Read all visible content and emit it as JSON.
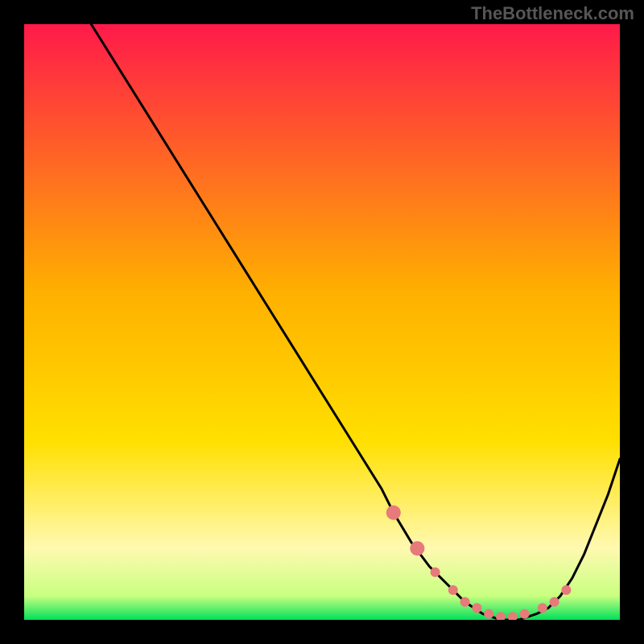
{
  "attribution": "TheBottleneck.com",
  "colors": {
    "bg": "#000000",
    "gradient_top": "#ff1a4a",
    "gradient_mid": "#ffd400",
    "gradient_low": "#fff9b0",
    "gradient_bottom": "#00e05a",
    "curve": "#000000",
    "markers": "#e77a7a"
  },
  "chart_data": {
    "type": "line",
    "title": "",
    "xlabel": "",
    "ylabel": "",
    "xlim": [
      0,
      100
    ],
    "ylim": [
      0,
      100
    ],
    "series": [
      {
        "name": "bottleneck-curve",
        "x": [
          0,
          5,
          10,
          15,
          20,
          25,
          30,
          35,
          40,
          45,
          50,
          55,
          60,
          62,
          65,
          68,
          71,
          74,
          77,
          80,
          83,
          86,
          88,
          90,
          92,
          94,
          96,
          98,
          100
        ],
        "y": [
          112,
          108,
          102,
          94,
          86,
          78,
          70,
          62,
          54,
          46,
          38,
          30,
          22,
          18,
          13,
          9,
          6,
          3,
          1,
          0,
          0,
          1,
          2,
          4,
          7,
          11,
          16,
          21,
          27
        ]
      }
    ],
    "markers": {
      "name": "highlight-dots",
      "x": [
        62,
        66,
        69,
        72,
        74,
        76,
        78,
        80,
        82,
        84,
        87,
        89,
        91
      ],
      "y": [
        18,
        12,
        8,
        5,
        3,
        2,
        1,
        0.5,
        0.5,
        1,
        2,
        3,
        5
      ]
    }
  }
}
